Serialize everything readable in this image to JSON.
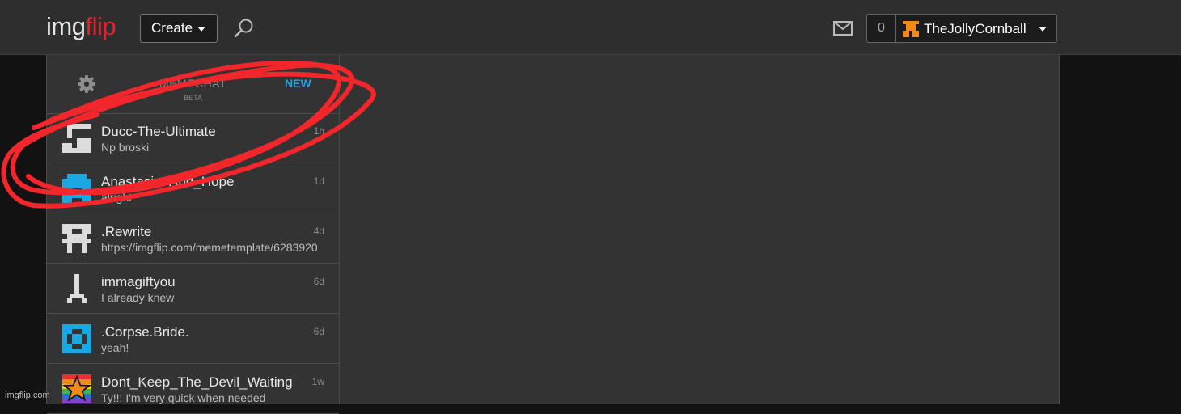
{
  "header": {
    "logo_part1": "img",
    "logo_part2": "flip",
    "create_label": "Create",
    "notification_count": "0",
    "username": "TheJollyCornball"
  },
  "chat": {
    "title": "MEMECHAT",
    "beta": "BETA",
    "new_label": "NEW",
    "conversations": [
      {
        "name": "Ducc-The-Ultimate",
        "message": "Np broski",
        "time": "1h"
      },
      {
        "name": "Anastasia_And_Hope",
        "message": "alright",
        "time": "1d"
      },
      {
        "name": ".Rewrite",
        "message": "https://imgflip.com/memetemplate/6283920",
        "time": "4d"
      },
      {
        "name": "immagiftyou",
        "message": "I already knew",
        "time": "6d"
      },
      {
        "name": ".Corpse.Bride.",
        "message": "yeah!",
        "time": "6d"
      },
      {
        "name": "Dont_Keep_The_Devil_Waiting",
        "message": "Ty!!! I'm very quick when needed",
        "time": "1w"
      }
    ]
  },
  "watermark": "imgflip.com",
  "colors": {
    "accent_new": "#1ea6e0",
    "logo_red": "#e0232e",
    "scribble": "#f2262b",
    "avatar_blue": "#1aa8e3",
    "avatar_orange": "#f28a1a"
  },
  "icons": [
    "search-icon",
    "mail-icon",
    "gear-icon",
    "chevron-down-icon"
  ]
}
